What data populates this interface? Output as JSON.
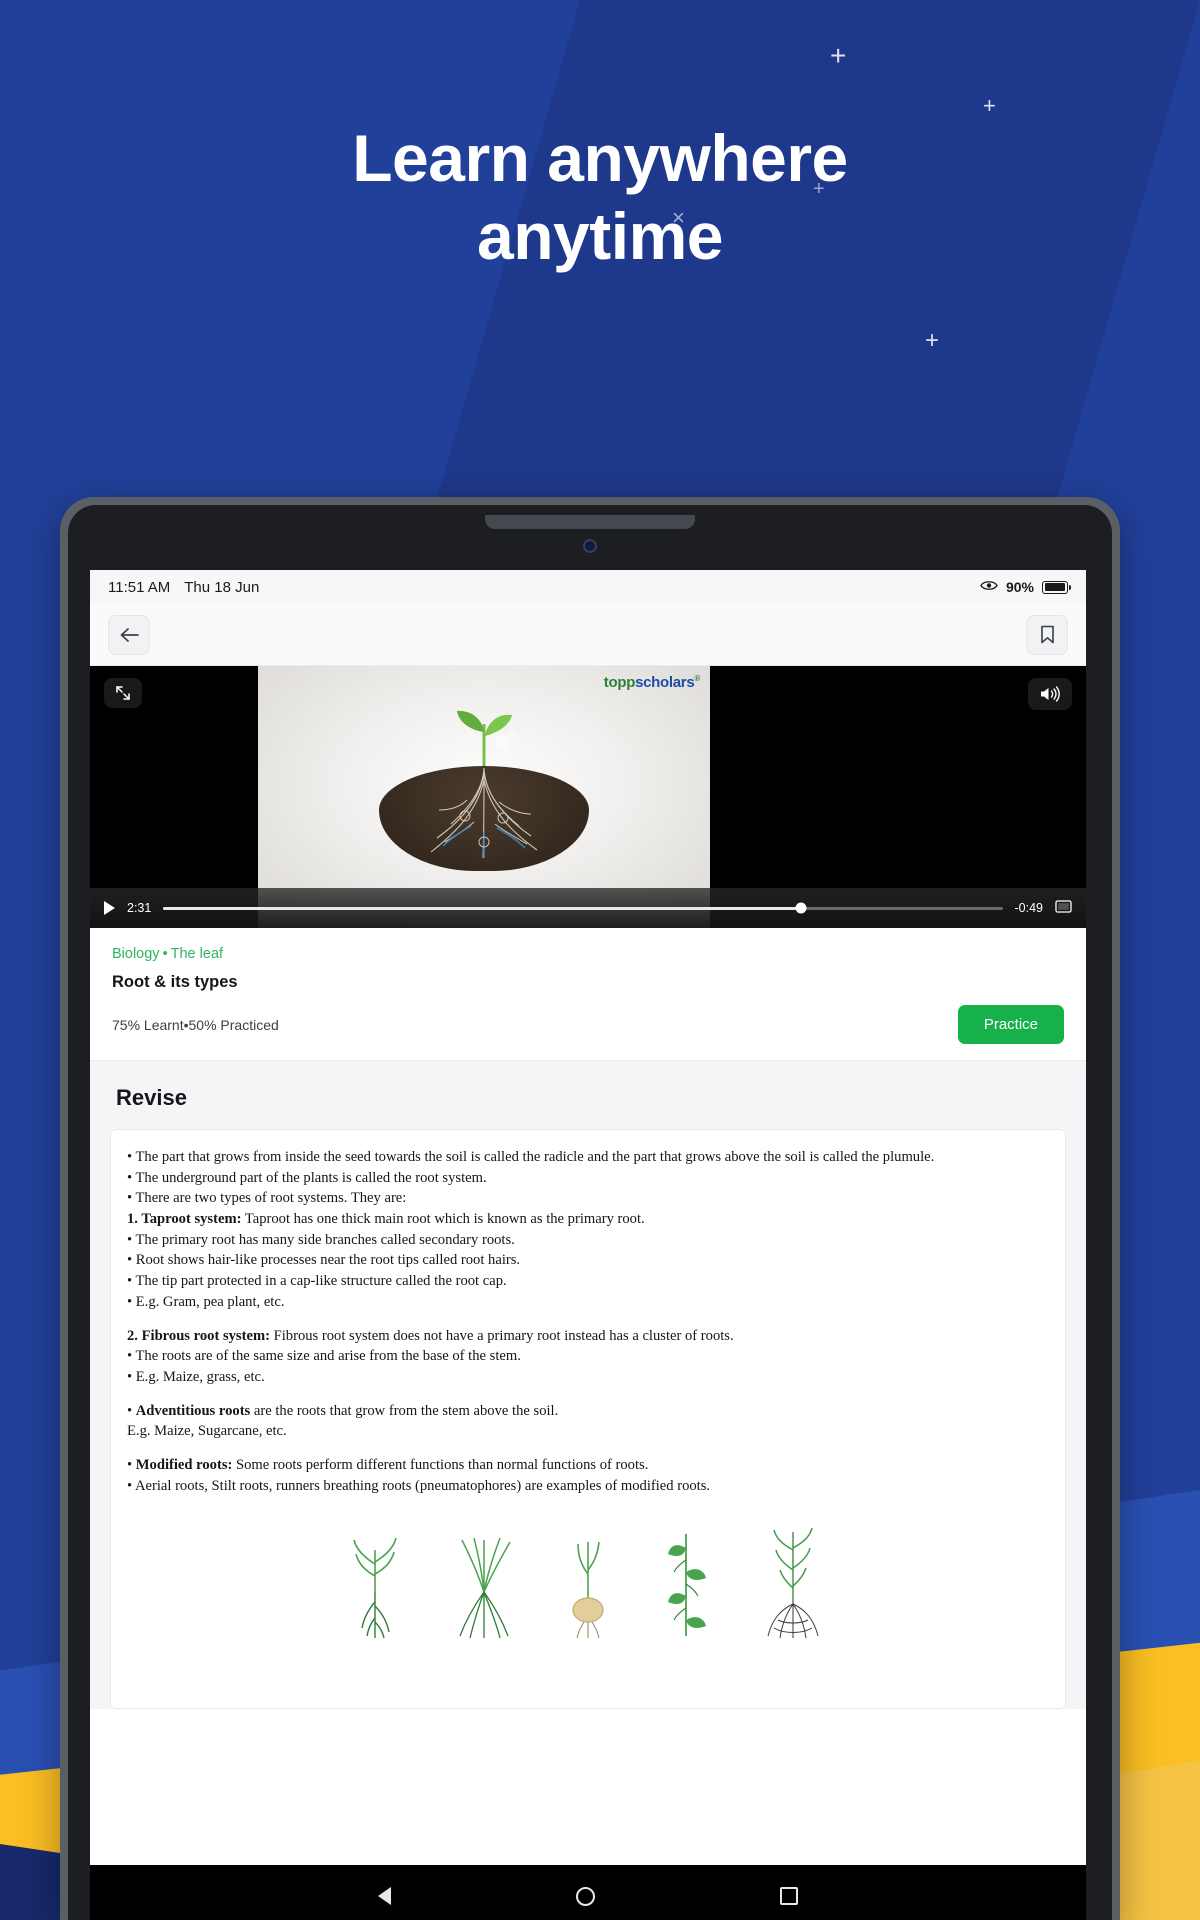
{
  "promo": {
    "headline_line1": "Learn anywhere",
    "headline_line2": "anytime",
    "marks": [
      "+",
      "+",
      "×",
      "+",
      "+"
    ]
  },
  "status_bar": {
    "time": "11:51 AM",
    "date": "Thu 18 Jun",
    "battery_percent": "90%",
    "eye_icon": "eye-comfort-icon",
    "battery_icon": "battery-icon"
  },
  "app_bar": {
    "back_icon": "arrow-left-icon",
    "bookmark_icon": "bookmark-icon"
  },
  "video": {
    "brand_part1": "topp",
    "brand_part2": "scholars",
    "brand_sup": "®",
    "current_time": "2:31",
    "remaining_time": "-0:49",
    "play_icon": "play-icon",
    "fullscreen_icon": "expand-icon",
    "volume_icon": "volume-up-icon",
    "cast_icon": "cast-icon",
    "progress_percent": 76
  },
  "lesson": {
    "breadcrumb_subject": "Biology",
    "breadcrumb_dot": "•",
    "breadcrumb_chapter": "The leaf",
    "title": "Root & its types",
    "learnt": "75%  Learnt",
    "separator": "•",
    "practiced": "50% Practiced",
    "practice_label": "Practice"
  },
  "revise": {
    "heading": "Revise",
    "notes": [
      {
        "text": "• The part that grows from inside the seed towards the soil is called the radicle and the part that grows above the soil is called the plumule."
      },
      {
        "text": "• The underground part of the plants is called the root system."
      },
      {
        "text": "• There are two types of root systems. They are:"
      },
      {
        "bold": "1. Taproot system:",
        "text": " Taproot has one thick main root which is known as the primary root."
      },
      {
        "text": "• The primary root has many side branches called secondary roots."
      },
      {
        "text": "• Root shows hair-like processes near the root tips called root hairs."
      },
      {
        "text": "• The tip part protected in a cap-like structure called the root cap."
      },
      {
        "text": "• E.g. Gram, pea plant, etc."
      },
      {
        "gap": true
      },
      {
        "bold": "2. Fibrous root system:",
        "text": " Fibrous root system does not have a primary root instead has a cluster of roots."
      },
      {
        "text": "• The roots are of the same size and arise from the base of the stem."
      },
      {
        "text": "• E.g. Maize, grass, etc."
      },
      {
        "gap": true
      },
      {
        "bullet": "• ",
        "bold": "Adventitious roots",
        "text": " are the roots that grow from the stem above the soil."
      },
      {
        "text": "E.g. Maize, Sugarcane, etc."
      },
      {
        "gap": true
      },
      {
        "bullet": "• ",
        "bold": "Modified roots:",
        "text": " Some roots perform different functions than normal functions of roots."
      },
      {
        "text": "• Aerial roots, Stilt roots, runners breathing roots (pneumatophores) are examples of modified roots."
      }
    ]
  },
  "nav_bar": {
    "back_icon": "triangle-back-icon",
    "home_icon": "circle-home-icon",
    "recents_icon": "square-recents-icon"
  },
  "colors": {
    "background_blue": "#21409a",
    "accent_green": "#16b14b",
    "breadcrumb_green": "#2eb462",
    "yellow": "#fbbf24"
  }
}
